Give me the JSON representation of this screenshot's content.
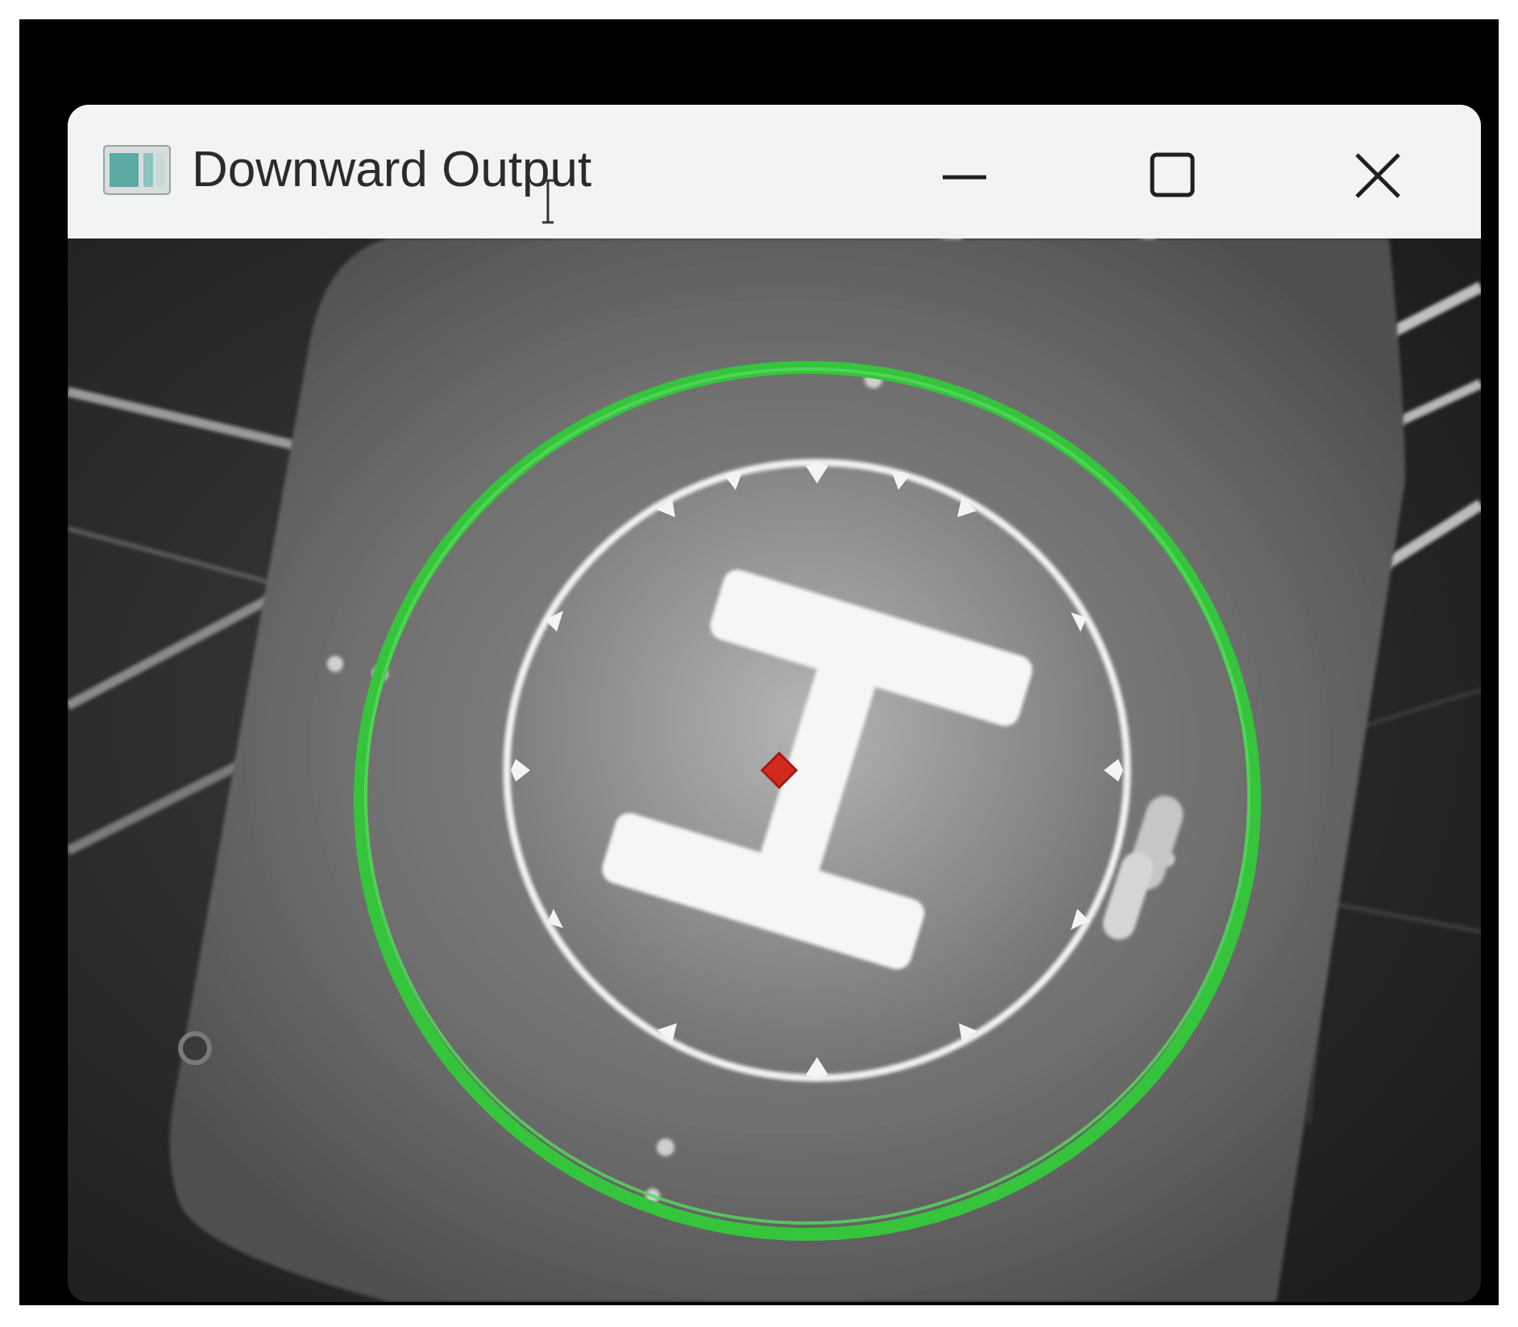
{
  "window": {
    "title": "Downward Output",
    "icon": "app-window-icon",
    "controls": {
      "minimize": "minimize-icon",
      "maximize": "maximize-icon",
      "close": "close-icon"
    }
  },
  "camera_view": {
    "scene": "helipad-landing-marker",
    "detection": {
      "circle_color": "#35c43c",
      "center_marker_color": "#d22a1e"
    }
  }
}
